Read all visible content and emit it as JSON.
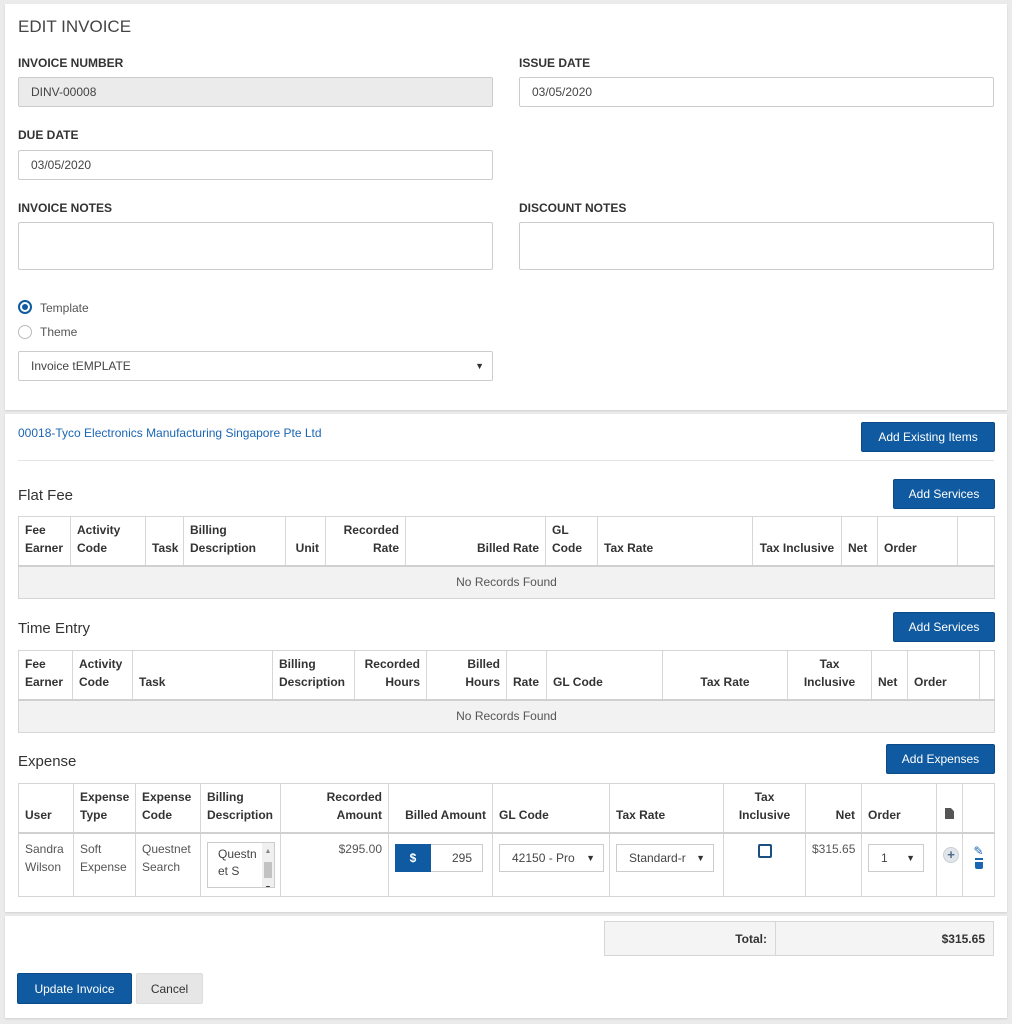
{
  "header": {
    "title": "EDIT INVOICE"
  },
  "fields": {
    "invoice_number_label": "INVOICE NUMBER",
    "invoice_number_value": "DINV-00008",
    "issue_date_label": "ISSUE DATE",
    "issue_date_value": "03/05/2020",
    "due_date_label": "DUE DATE",
    "due_date_value": "03/05/2020",
    "invoice_notes_label": "INVOICE NOTES",
    "discount_notes_label": "DISCOUNT NOTES"
  },
  "template_options": {
    "template_label": "Template",
    "theme_label": "Theme",
    "selected": "Template",
    "select_value": "Invoice tEMPLATE"
  },
  "client": {
    "link": "00018-Tyco Electronics Manufacturing Singapore Pte Ltd",
    "add_existing_label": "Add Existing Items"
  },
  "flat_fee": {
    "title": "Flat Fee",
    "add_label": "Add Services",
    "columns": [
      "Fee Earner",
      "Activity Code",
      "Task",
      "Billing Description",
      "Unit",
      "Recorded Rate",
      "Billed Rate",
      "GL Code",
      "Tax Rate",
      "Tax Inclusive",
      "Net",
      "Order"
    ],
    "empty": "No Records Found"
  },
  "time_entry": {
    "title": "Time Entry",
    "add_label": "Add Services",
    "columns": [
      "Fee Earner",
      "Activity Code",
      "Task",
      "Billing Description",
      "Recorded Hours",
      "Billed Hours",
      "Rate",
      "GL Code",
      "Tax Rate",
      "Tax Inclusive",
      "Net",
      "Order"
    ],
    "empty": "No Records Found"
  },
  "expense": {
    "title": "Expense",
    "add_label": "Add Expenses",
    "columns": [
      "User",
      "Expense Type",
      "Expense Code",
      "Billing Description",
      "Recorded Amount",
      "Billed Amount",
      "GL Code",
      "Tax Rate",
      "Tax Inclusive",
      "Net",
      "Order"
    ],
    "row": {
      "user": "Sandra Wilson",
      "expense_type": "Soft Expense",
      "expense_code": "Questnet Search",
      "billing_description": "Questnet S",
      "recorded_amount": "$295.00",
      "currency_symbol": "$",
      "billed_amount": "295",
      "gl_code": "42150 - Pro",
      "tax_rate": "Standard-r",
      "tax_inclusive": false,
      "net": "$315.65",
      "order": "1"
    }
  },
  "totals": {
    "label": "Total:",
    "value": "$315.65"
  },
  "footer": {
    "update_label": "Update Invoice",
    "cancel_label": "Cancel"
  },
  "colors": {
    "primary": "#0f5aa0",
    "link": "#1a66b3",
    "readonly_bg": "#ebebeb",
    "empty_row_bg": "#f2f2f2"
  }
}
